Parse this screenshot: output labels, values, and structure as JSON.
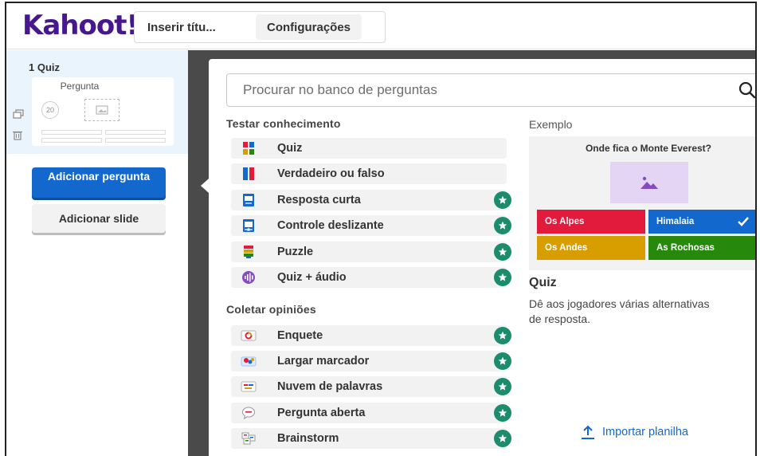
{
  "header": {
    "logo": "Kahoot!",
    "title_input_value": "Inserir títu...",
    "settings_label": "Configurações"
  },
  "sidebar": {
    "slide": {
      "number_label": "1  Quiz",
      "thumb_title": "Pergunta",
      "timer": "20"
    },
    "add_question_label": "Adicionar pergunta",
    "add_slide_label": "Adicionar slide"
  },
  "search": {
    "placeholder": "Procurar no banco de perguntas"
  },
  "sections": {
    "test_title": "Testar conhecimento",
    "opinion_title": "Coletar opiniões"
  },
  "test_types": [
    {
      "label": "Quiz",
      "icon": "quiz-icon",
      "premium": false
    },
    {
      "label": "Verdadeiro ou falso",
      "icon": "true-false-icon",
      "premium": false
    },
    {
      "label": "Resposta curta",
      "icon": "short-answer-icon",
      "premium": true
    },
    {
      "label": "Controle deslizante",
      "icon": "slider-icon",
      "premium": true
    },
    {
      "label": "Puzzle",
      "icon": "puzzle-icon",
      "premium": true
    },
    {
      "label": "Quiz + áudio",
      "icon": "audio-icon",
      "premium": true
    }
  ],
  "opinion_types": [
    {
      "label": "Enquete",
      "icon": "poll-icon",
      "premium": true
    },
    {
      "label": "Largar marcador",
      "icon": "drop-pin-icon",
      "premium": true
    },
    {
      "label": "Nuvem de palavras",
      "icon": "word-cloud-icon",
      "premium": true
    },
    {
      "label": "Pergunta aberta",
      "icon": "open-ended-icon",
      "premium": true
    },
    {
      "label": "Brainstorm",
      "icon": "brainstorm-icon",
      "premium": true
    }
  ],
  "example": {
    "heading": "Exemplo",
    "question": "Onde fica o Monte Everest?",
    "answers": [
      {
        "text": "Os Alpes",
        "color": "#e21b3c",
        "correct": false
      },
      {
        "text": "Himalaia",
        "color": "#1368ce",
        "correct": true
      },
      {
        "text": "Os Andes",
        "color": "#d89e00",
        "correct": false
      },
      {
        "text": "As Rochosas",
        "color": "#26890c",
        "correct": false
      }
    ],
    "type_name": "Quiz",
    "description": "Dê aos jogadores várias alternativas de resposta."
  },
  "import_label": "Importar planilha",
  "colors": {
    "brand": "#46178f",
    "primary_blue": "#1368ce",
    "premium_star": "#1c8c6c"
  }
}
